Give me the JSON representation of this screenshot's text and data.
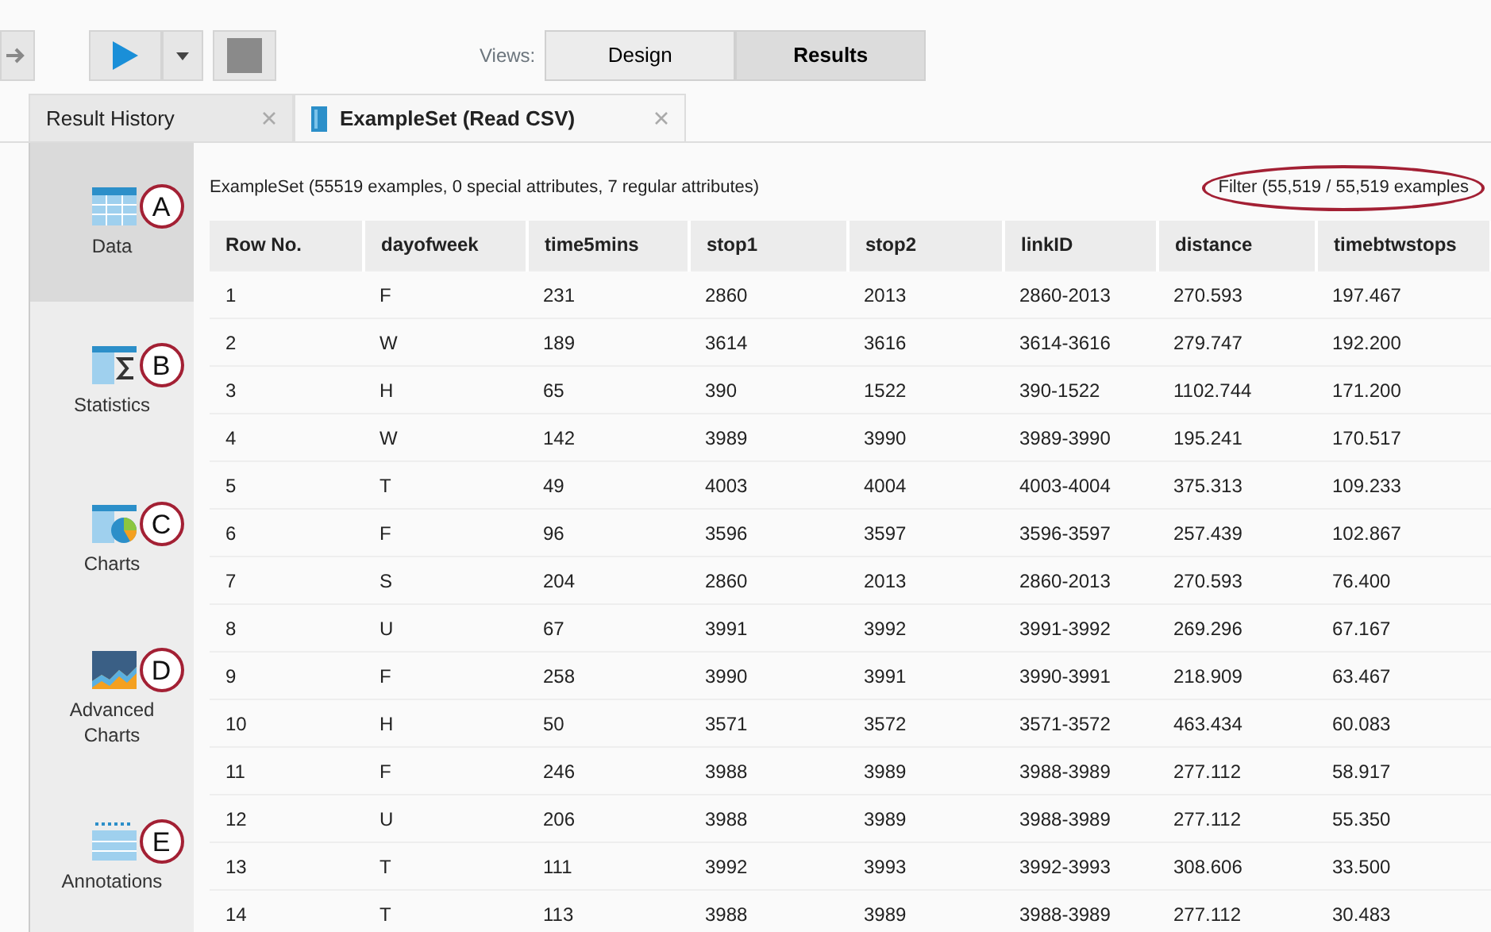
{
  "toolbar": {
    "views_label": "Views:",
    "views": [
      {
        "label": "Design",
        "selected": false
      },
      {
        "label": "Results",
        "selected": true
      }
    ]
  },
  "tabs": [
    {
      "label": "Result History",
      "selected": false,
      "icon": false
    },
    {
      "label": "ExampleSet (Read CSV)",
      "selected": true,
      "icon": true
    }
  ],
  "sidebar": {
    "items": [
      {
        "label": "Data",
        "kind": "data",
        "selected": true,
        "callout": "A"
      },
      {
        "label": "Statistics",
        "kind": "statistics",
        "selected": false,
        "callout": "B"
      },
      {
        "label": "Charts",
        "kind": "charts",
        "selected": false,
        "callout": "C"
      },
      {
        "label": "Advanced Charts",
        "kind": "advanced",
        "selected": false,
        "callout": "D"
      },
      {
        "label": "Annotations",
        "kind": "annotations",
        "selected": false,
        "callout": "E"
      }
    ]
  },
  "summary": "ExampleSet (55519 examples, 0 special attributes, 7 regular attributes)",
  "filter": "Filter (55,519 / 55,519 examples",
  "table": {
    "columns": [
      "Row No.",
      "dayofweek",
      "time5mins",
      "stop1",
      "stop2",
      "linkID",
      "distance",
      "timebtwstops"
    ],
    "rows": [
      [
        "1",
        "F",
        "231",
        "2860",
        "2013",
        "2860-2013",
        "270.593",
        "197.467"
      ],
      [
        "2",
        "W",
        "189",
        "3614",
        "3616",
        "3614-3616",
        "279.747",
        "192.200"
      ],
      [
        "3",
        "H",
        "65",
        "390",
        "1522",
        "390-1522",
        "1102.744",
        "171.200"
      ],
      [
        "4",
        "W",
        "142",
        "3989",
        "3990",
        "3989-3990",
        "195.241",
        "170.517"
      ],
      [
        "5",
        "T",
        "49",
        "4003",
        "4004",
        "4003-4004",
        "375.313",
        "109.233"
      ],
      [
        "6",
        "F",
        "96",
        "3596",
        "3597",
        "3596-3597",
        "257.439",
        "102.867"
      ],
      [
        "7",
        "S",
        "204",
        "2860",
        "2013",
        "2860-2013",
        "270.593",
        "76.400"
      ],
      [
        "8",
        "U",
        "67",
        "3991",
        "3992",
        "3991-3992",
        "269.296",
        "67.167"
      ],
      [
        "9",
        "F",
        "258",
        "3990",
        "3991",
        "3990-3991",
        "218.909",
        "63.467"
      ],
      [
        "10",
        "H",
        "50",
        "3571",
        "3572",
        "3571-3572",
        "463.434",
        "60.083"
      ],
      [
        "11",
        "F",
        "246",
        "3988",
        "3989",
        "3988-3989",
        "277.112",
        "58.917"
      ],
      [
        "12",
        "U",
        "206",
        "3988",
        "3989",
        "3988-3989",
        "277.112",
        "55.350"
      ],
      [
        "13",
        "T",
        "111",
        "3992",
        "3993",
        "3992-3993",
        "308.606",
        "33.500"
      ],
      [
        "14",
        "T",
        "113",
        "3988",
        "3989",
        "3988-3989",
        "277.112",
        "30.483"
      ]
    ]
  }
}
